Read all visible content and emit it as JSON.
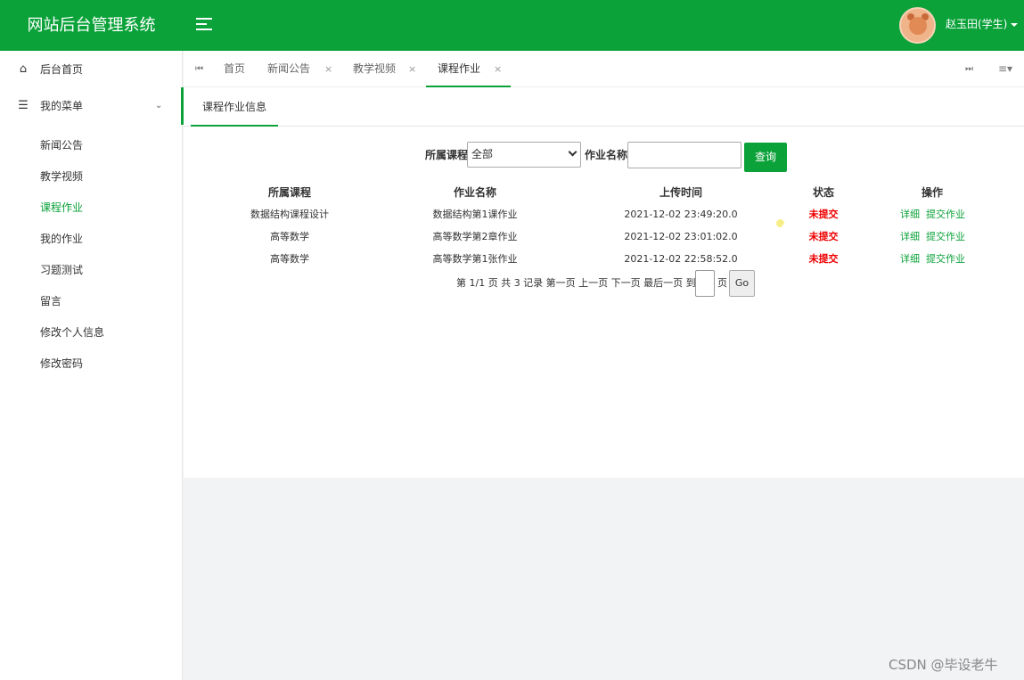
{
  "header": {
    "title": "网站后台管理系统",
    "user": "赵玉田(学生)"
  },
  "sidebar": {
    "home": "后台首页",
    "my_menu": "我的菜单",
    "items": [
      "新闻公告",
      "教学视频",
      "课程作业",
      "我的作业",
      "习题测试",
      "留言",
      "修改个人信息",
      "修改密码"
    ],
    "active_index": 2
  },
  "tabs": {
    "items": [
      "首页",
      "新闻公告",
      "教学视频",
      "课程作业"
    ],
    "active": "课程作业"
  },
  "panel": {
    "title": "课程作业信息"
  },
  "search": {
    "course_label": "所属课程:",
    "course_value": "全部",
    "name_label": "作业名称:",
    "button": "查询"
  },
  "table": {
    "headers": [
      "所属课程",
      "作业名称",
      "上传时间",
      "状态",
      "操作"
    ],
    "rows": [
      {
        "course": "数据结构课程设计",
        "name": "数据结构第1课作业",
        "time": "2021-12-02 23:49:20.0",
        "status": "未提交",
        "detail": "详细",
        "submit": "提交作业"
      },
      {
        "course": "高等数学",
        "name": "高等数学第2章作业",
        "time": "2021-12-02 23:01:02.0",
        "status": "未提交",
        "detail": "详细",
        "submit": "提交作业"
      },
      {
        "course": "高等数学",
        "name": "高等数学第1张作业",
        "time": "2021-12-02 22:58:52.0",
        "status": "未提交",
        "detail": "详细",
        "submit": "提交作业"
      }
    ]
  },
  "pager": {
    "text": "第 1/1 页 共 3 记录 第一页 上一页 下一页 最后一页 到",
    "page_suffix": "页",
    "go": "Go"
  },
  "watermark": "CSDN @毕设老牛",
  "colors": {
    "accent": "#0ba23a",
    "status": "#ee0000"
  }
}
